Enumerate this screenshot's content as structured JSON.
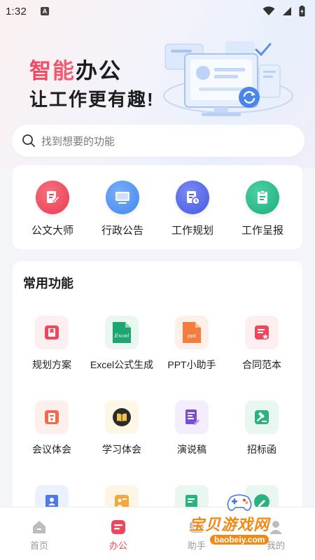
{
  "status_bar": {
    "time": "1:32",
    "badge": "A"
  },
  "hero": {
    "title_highlight": "智能",
    "title_rest": "办公",
    "subtitle": "让工作更有趣!"
  },
  "search": {
    "placeholder": "找到想要的功能"
  },
  "quick_actions": [
    {
      "label": "公文大师",
      "icon": "document-pen-icon",
      "color": "#f0455d"
    },
    {
      "label": "行政公告",
      "icon": "monitor-icon",
      "color": "#4b8ef2"
    },
    {
      "label": "工作规划",
      "icon": "document-clock-icon",
      "color": "#4f63e6"
    },
    {
      "label": "工作呈报",
      "icon": "clipboard-icon",
      "color": "#22b88a"
    }
  ],
  "common": {
    "title": "常用功能",
    "items": [
      {
        "label": "规划方案",
        "icon": "bookmark-doc-icon",
        "color": "#f0455d"
      },
      {
        "label": "Excel公式生成",
        "icon": "excel-file-icon",
        "color": "#1ea672",
        "icon_text": "Excel"
      },
      {
        "label": "PPT小助手",
        "icon": "ppt-file-icon",
        "color": "#f37d3f",
        "icon_text": "ppt"
      },
      {
        "label": "合同范本",
        "icon": "contract-icon",
        "color": "#f0455d"
      },
      {
        "label": "会议体会",
        "icon": "meeting-note-icon",
        "color": "#f5684a"
      },
      {
        "label": "学习体会",
        "icon": "book-icon",
        "color": "#2b2b2b"
      },
      {
        "label": "演说稿",
        "icon": "speech-doc-icon",
        "color": "#7a4fd8"
      },
      {
        "label": "招标函",
        "icon": "gavel-icon",
        "color": "#2bb27f"
      },
      {
        "label": "",
        "icon": "profile-card-icon",
        "color": "#4b7be8"
      },
      {
        "label": "",
        "icon": "person-board-icon",
        "color": "#f2a93b"
      },
      {
        "label": "",
        "icon": "edit-doc-icon",
        "color": "#2bb27f"
      },
      {
        "label": "",
        "icon": "pencil-icon",
        "color": "#2bb27f"
      }
    ]
  },
  "tabbar": [
    {
      "label": "首页",
      "icon": "home-icon",
      "active": false
    },
    {
      "label": "办公",
      "icon": "office-icon",
      "active": true
    },
    {
      "label": "助手",
      "icon": "assistant-icon",
      "active": false
    },
    {
      "label": "我的",
      "icon": "profile-icon",
      "active": false
    }
  ],
  "watermark": {
    "text": "宝贝游戏网",
    "url": "baobeiy.com"
  },
  "colors": {
    "accent": "#f0455d",
    "background": "#f4f5f9"
  }
}
